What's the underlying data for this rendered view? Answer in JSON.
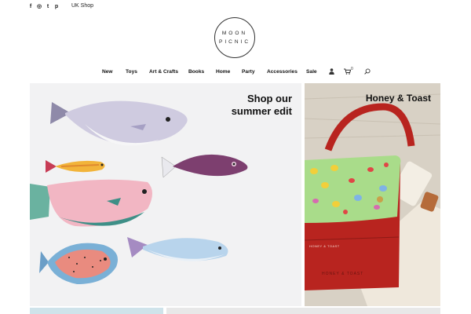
{
  "topbar": {
    "social_icons": [
      "facebook-icon",
      "instagram-icon",
      "twitter-icon",
      "pinterest-icon"
    ],
    "social_glyphs": [
      "f",
      "◎",
      "t",
      "p"
    ],
    "shop_region": "UK Shop"
  },
  "logo": {
    "line1": "MOON",
    "line2": "PICNIC"
  },
  "nav": {
    "items": [
      "New",
      "Toys",
      "Art & Crafts",
      "Books",
      "Home",
      "Party",
      "Accessories",
      "Sale"
    ],
    "cart_count": "0"
  },
  "hero": {
    "left_headline_line1": "Shop our",
    "left_headline_line2": "summer edit",
    "right_headline": "Honey & Toast",
    "bag_brand": "HONEY & TOAST"
  },
  "colors": {
    "background": "#ffffff",
    "left_panel": "#f2f2f3",
    "bag_red": "#b8241f",
    "flap_green": "#a9dc8a"
  }
}
